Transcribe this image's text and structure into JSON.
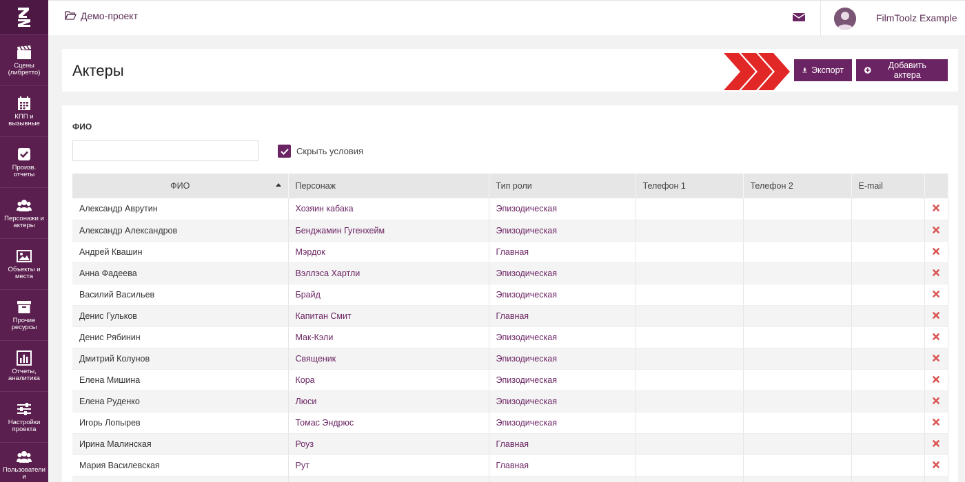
{
  "sidebar": {
    "items": [
      {
        "label": "Сцены\n(либретто)"
      },
      {
        "label": "КПП и\nвызывные"
      },
      {
        "label": "Произв.\nотчеты"
      },
      {
        "label": "Персонажи и\nактеры"
      },
      {
        "label": "Объекты и\nместа"
      },
      {
        "label": "Прочие\nресурсы"
      },
      {
        "label": "Отчеты,\nаналитика"
      },
      {
        "label": "Настройки\nпроекта"
      },
      {
        "label": "Пользователи и\nроли"
      }
    ]
  },
  "header": {
    "project_name": "Демо-проект",
    "user_name": "FilmToolz Example"
  },
  "main": {
    "title": "Актеры",
    "export_label": "Экспорт",
    "add_label": "Добавить актера",
    "filter_label": "ФИО",
    "filter_value": "",
    "hide_conditions_label": "Скрыть условия",
    "hide_conditions_checked": true
  },
  "table": {
    "columns": [
      "ФИО",
      "Персонаж",
      "Тип роли",
      "Телефон 1",
      "Телефон 2",
      "E-mail"
    ],
    "rows": [
      {
        "name": "Александр Аврутин",
        "character": "Хозяин кабака",
        "role": "Эпизодическая",
        "phone1": "",
        "phone2": "",
        "email": ""
      },
      {
        "name": "Александр Александров",
        "character": "Бенджамин Гугенхейм",
        "role": "Эпизодическая",
        "phone1": "",
        "phone2": "",
        "email": ""
      },
      {
        "name": "Андрей Квашин",
        "character": "Мэрдок",
        "role": "Главная",
        "phone1": "",
        "phone2": "",
        "email": ""
      },
      {
        "name": "Анна Фадеева",
        "character": "Вэллэса Хартли",
        "role": "Эпизодическая",
        "phone1": "",
        "phone2": "",
        "email": ""
      },
      {
        "name": "Василий Васильев",
        "character": "Брайд",
        "role": "Эпизодическая",
        "phone1": "",
        "phone2": "",
        "email": ""
      },
      {
        "name": "Денис Гульков",
        "character": "Капитан Смит",
        "role": "Главная",
        "phone1": "",
        "phone2": "",
        "email": ""
      },
      {
        "name": "Денис Рябинин",
        "character": "Мак-Кэли",
        "role": "Эпизодическая",
        "phone1": "",
        "phone2": "",
        "email": ""
      },
      {
        "name": "Дмитрий Колунов",
        "character": "Священик",
        "role": "Эпизодическая",
        "phone1": "",
        "phone2": "",
        "email": ""
      },
      {
        "name": "Елена Мишина",
        "character": "Кора",
        "role": "Эпизодическая",
        "phone1": "",
        "phone2": "",
        "email": ""
      },
      {
        "name": "Елена Руденко",
        "character": "Люси",
        "role": "Эпизодическая",
        "phone1": "",
        "phone2": "",
        "email": ""
      },
      {
        "name": "Игорь Лопырев",
        "character": "Томас Эндрюс",
        "role": "Эпизодическая",
        "phone1": "",
        "phone2": "",
        "email": ""
      },
      {
        "name": "Ирина Малинская",
        "character": "Роуз",
        "role": "Главная",
        "phone1": "",
        "phone2": "",
        "email": ""
      },
      {
        "name": "Мария Василевская",
        "character": "Рут",
        "role": "Главная",
        "phone1": "",
        "phone2": "",
        "email": ""
      },
      {
        "name": "",
        "character": "",
        "role": "",
        "phone1": "",
        "phone2": "",
        "email": ""
      }
    ]
  },
  "icons": {
    "logo": "fz-logo-icon",
    "project": "folder-open-icon",
    "mail": "envelope-icon",
    "export": "download-icon",
    "add": "plus-circle-icon",
    "delete": "times-icon"
  },
  "colors": {
    "sidebar": "#5b1f4f",
    "accent": "#6b2463",
    "delete": "#d9534f",
    "arrow": "#e22727"
  }
}
